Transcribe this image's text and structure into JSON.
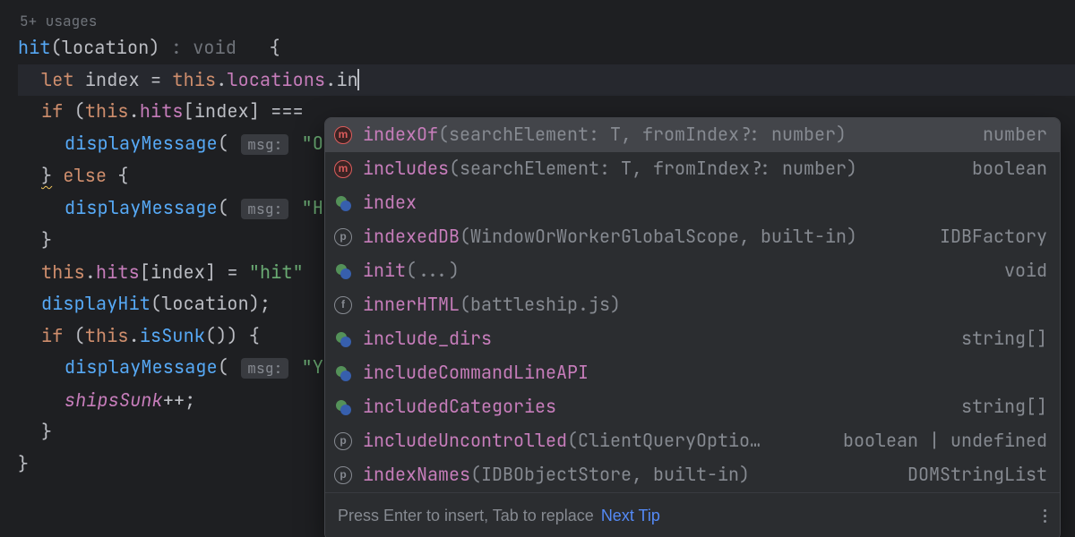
{
  "hint": {
    "usages": "5+ usages"
  },
  "code": {
    "fn_name": "hit",
    "param": "location",
    "ret_hint": ": void",
    "let_kw": "let",
    "index_var": "index",
    "this_kw": "this",
    "locations_prop": "locations",
    "typed": "in",
    "if_kw": "if",
    "hits_prop": "hits",
    "eq": "===",
    "msg_label": "msg:",
    "str_o": "\"O",
    "else_kw": "else",
    "str_h": "\"H",
    "str_hit": "\"hit\"",
    "displayHit": "displayHit",
    "displayMessage": "displayMessage",
    "isSunk": "isSunk",
    "str_y": "\"Y",
    "shipsSunk": "shipsSunk",
    "pp": "++;"
  },
  "completions": [
    {
      "icon": "m",
      "name": "indexOf",
      "sig": "(searchElement: T, fromIndex?: number)",
      "right": "number"
    },
    {
      "icon": "m",
      "name": "includes",
      "sig": "(searchElement: T, fromIndex?: number)",
      "right": "boolean"
    },
    {
      "icon": "v",
      "name": "index",
      "sig": "",
      "right": ""
    },
    {
      "icon": "p",
      "name": "indexedDB",
      "sig": " (WindowOrWorkerGlobalScope, built-in)",
      "right": "IDBFactory"
    },
    {
      "icon": "v",
      "name": "init",
      "sig": "(...)",
      "right": "void"
    },
    {
      "icon": "f",
      "name": "innerHTML",
      "sig": " (battleship.js)",
      "right": ""
    },
    {
      "icon": "v",
      "name": "include_dirs",
      "sig": "",
      "right": "string[]"
    },
    {
      "icon": "v",
      "name": "includeCommandLineAPI",
      "sig": "",
      "right": ""
    },
    {
      "icon": "v",
      "name": "includedCategories",
      "sig": "",
      "right": "string[]"
    },
    {
      "icon": "p",
      "name": "includeUncontrolled",
      "sig": " (ClientQueryOptio…",
      "right": "boolean | undefined"
    },
    {
      "icon": "p",
      "name": "indexNames",
      "sig": " (IDBObjectStore, built-in)",
      "right": "DOMStringList"
    }
  ],
  "footer": {
    "text": "Press Enter to insert, Tab to replace",
    "link": "Next Tip"
  }
}
